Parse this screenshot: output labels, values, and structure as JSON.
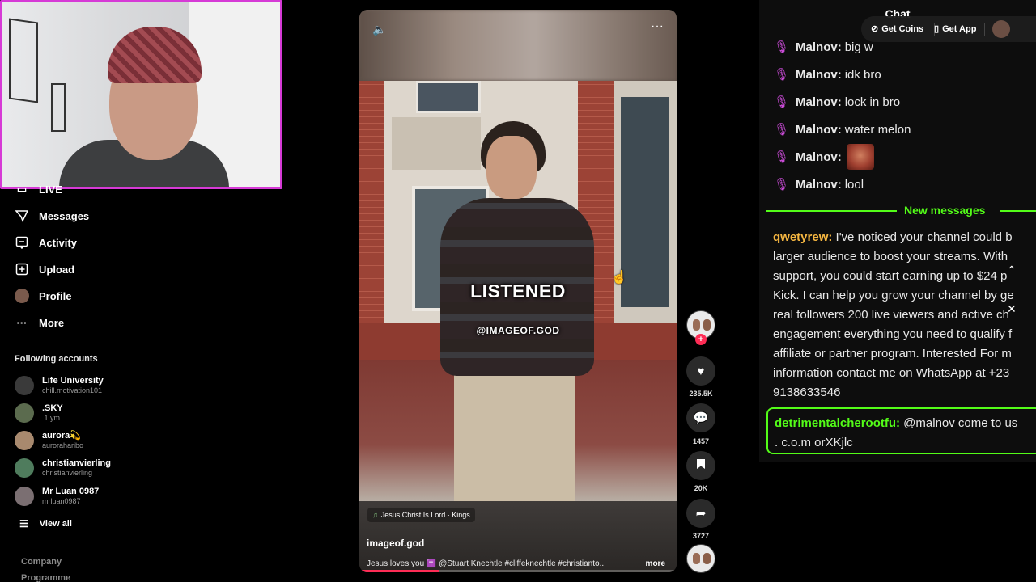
{
  "sidebar": {
    "nav": [
      {
        "label": "LIVE",
        "icon": "live-icon"
      },
      {
        "label": "Messages",
        "icon": "messages-icon"
      },
      {
        "label": "Activity",
        "icon": "activity-icon"
      },
      {
        "label": "Upload",
        "icon": "upload-icon"
      },
      {
        "label": "Profile",
        "icon": "profile-avatar"
      },
      {
        "label": "More",
        "icon": "more-icon"
      }
    ],
    "following_title": "Following accounts",
    "accounts": [
      {
        "name": "Life University",
        "handle": "chill.motivation101",
        "color": "#3a3a3a"
      },
      {
        "name": ".SKY",
        "handle": ".1.ym",
        "color": "#5b6b4e"
      },
      {
        "name": "aurora💫",
        "handle": "auroraharibo",
        "color": "#a8896e"
      },
      {
        "name": "christianvierling",
        "handle": "christianvierling",
        "color": "#4f7c5d"
      },
      {
        "name": "Mr Luan 0987",
        "handle": "mrluan0987",
        "color": "#7b6f72"
      }
    ],
    "view_all": "View all",
    "footer": [
      "Company",
      "Programme"
    ]
  },
  "video": {
    "overlay_main": "LISTENED",
    "overlay_sub": "@IMAGEOF.GOD",
    "music": "Jesus Christ Is Lord · Kings",
    "username": "imageof.god",
    "description": "Jesus loves you ✝️ @Stuart Knechtle #cliffeknechtle #christianto...",
    "more": "more",
    "progress": 0.25
  },
  "actions": {
    "likes": "235.5K",
    "comments": "1457",
    "saves": "20K",
    "shares": "3727"
  },
  "chat": {
    "title": "Chat",
    "get_coins": "Get Coins",
    "get_app": "Get App",
    "messages": [
      {
        "user": "Malnov:",
        "text": "big w"
      },
      {
        "user": "Malnov:",
        "text": "idk bro"
      },
      {
        "user": "Malnov:",
        "text": "lock in bro"
      },
      {
        "user": "Malnov:",
        "text": "water melon"
      },
      {
        "user": "Malnov:",
        "text": ""
      },
      {
        "user": "Malnov:",
        "text": "lool"
      }
    ],
    "new_messages_label": "New messages",
    "long_message": {
      "user": "qwetyrew:",
      "lines": [
        " I've noticed your channel could b",
        "larger audience to boost your streams. With",
        "support, you could start earning up to $24 p",
        "Kick. I can help you grow your channel by ge",
        "real followers 200 live viewers and active ch",
        "engagement everything you need to qualify f",
        "affiliate or partner program. Interested For m",
        "information contact me on WhatsApp at +23",
        "9138633546"
      ]
    },
    "highlight_message": {
      "user": "detrimentalcherootfu:",
      "line1": " @malnov come to us",
      "line2": ". c.o.m orXKjlc"
    }
  }
}
